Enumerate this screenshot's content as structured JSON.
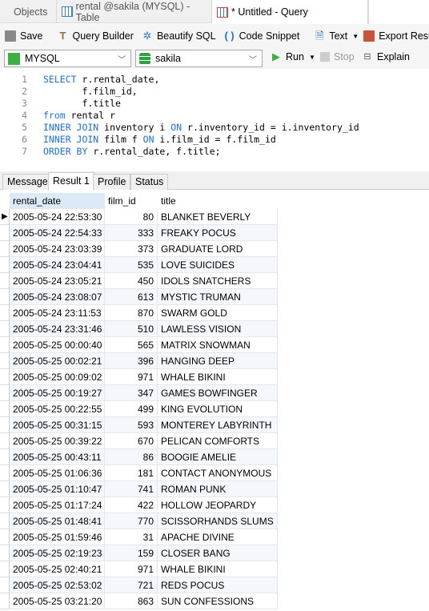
{
  "tabs": [
    {
      "label": "Objects"
    },
    {
      "label": "rental @sakila (MYSQL) - Table",
      "icon": "table-icon"
    },
    {
      "label": "* Untitled - Query",
      "icon": "query-icon",
      "active": true
    }
  ],
  "toolbar": {
    "save": "Save",
    "query_builder": "Query Builder",
    "beautify": "Beautify SQL",
    "snippet": "Code Snippet",
    "text": "Text",
    "export": "Export Result"
  },
  "connection": {
    "value": "MYSQL",
    "database": "sakila",
    "run": "Run",
    "stop": "Stop",
    "explain": "Explain"
  },
  "editor": {
    "lines": [
      [
        {
          "k": 1,
          "t": "SELECT"
        },
        {
          "k": 0,
          "t": " r.rental_date,"
        }
      ],
      [
        {
          "k": 0,
          "t": "       f.film_id,"
        }
      ],
      [
        {
          "k": 0,
          "t": "       f.title"
        }
      ],
      [
        {
          "k": 1,
          "t": "from"
        },
        {
          "k": 0,
          "t": " rental r"
        }
      ],
      [
        {
          "k": 1,
          "t": "INNER JOIN"
        },
        {
          "k": 0,
          "t": " inventory i "
        },
        {
          "k": 1,
          "t": "ON"
        },
        {
          "k": 0,
          "t": " r.inventory_id = i.inventory_id"
        }
      ],
      [
        {
          "k": 1,
          "t": "INNER JOIN"
        },
        {
          "k": 0,
          "t": " film f "
        },
        {
          "k": 1,
          "t": "ON"
        },
        {
          "k": 0,
          "t": " i.film_id = f.film_id"
        }
      ],
      [
        {
          "k": 1,
          "t": "ORDER BY"
        },
        {
          "k": 0,
          "t": " r.rental_date, f.title;"
        }
      ]
    ]
  },
  "result_tabs": [
    "Message",
    "Result 1",
    "Profile",
    "Status"
  ],
  "active_result_tab": 1,
  "columns": [
    "rental_date",
    "film_id",
    "title"
  ],
  "rows": [
    [
      "2005-05-24 22:53:30",
      "80",
      "BLANKET BEVERLY"
    ],
    [
      "2005-05-24 22:54:33",
      "333",
      "FREAKY POCUS"
    ],
    [
      "2005-05-24 23:03:39",
      "373",
      "GRADUATE LORD"
    ],
    [
      "2005-05-24 23:04:41",
      "535",
      "LOVE SUICIDES"
    ],
    [
      "2005-05-24 23:05:21",
      "450",
      "IDOLS SNATCHERS"
    ],
    [
      "2005-05-24 23:08:07",
      "613",
      "MYSTIC TRUMAN"
    ],
    [
      "2005-05-24 23:11:53",
      "870",
      "SWARM GOLD"
    ],
    [
      "2005-05-24 23:31:46",
      "510",
      "LAWLESS VISION"
    ],
    [
      "2005-05-25 00:00:40",
      "565",
      "MATRIX SNOWMAN"
    ],
    [
      "2005-05-25 00:02:21",
      "396",
      "HANGING DEEP"
    ],
    [
      "2005-05-25 00:09:02",
      "971",
      "WHALE BIKINI"
    ],
    [
      "2005-05-25 00:19:27",
      "347",
      "GAMES BOWFINGER"
    ],
    [
      "2005-05-25 00:22:55",
      "499",
      "KING EVOLUTION"
    ],
    [
      "2005-05-25 00:31:15",
      "593",
      "MONTEREY LABYRINTH"
    ],
    [
      "2005-05-25 00:39:22",
      "670",
      "PELICAN COMFORTS"
    ],
    [
      "2005-05-25 00:43:11",
      "86",
      "BOOGIE AMELIE"
    ],
    [
      "2005-05-25 01:06:36",
      "181",
      "CONTACT ANONYMOUS"
    ],
    [
      "2005-05-25 01:10:47",
      "741",
      "ROMAN PUNK"
    ],
    [
      "2005-05-25 01:17:24",
      "422",
      "HOLLOW JEOPARDY"
    ],
    [
      "2005-05-25 01:48:41",
      "770",
      "SCISSORHANDS SLUMS"
    ],
    [
      "2005-05-25 01:59:46",
      "31",
      "APACHE DIVINE"
    ],
    [
      "2005-05-25 02:19:23",
      "159",
      "CLOSER BANG"
    ],
    [
      "2005-05-25 02:40:21",
      "971",
      "WHALE BIKINI"
    ],
    [
      "2005-05-25 02:53:02",
      "721",
      "REDS POCUS"
    ],
    [
      "2005-05-25 03:21:20",
      "863",
      "SUN CONFESSIONS"
    ]
  ],
  "colors": {
    "keyword": "#1e6fd9",
    "run": "#3cb043",
    "header_selected": "#dce9f7"
  }
}
